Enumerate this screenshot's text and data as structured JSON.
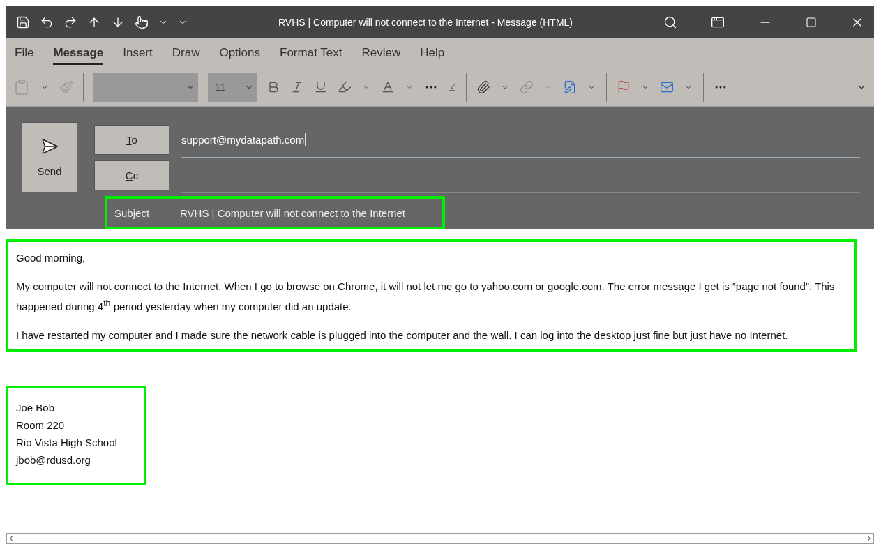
{
  "title_bar": {
    "title": "RVHS | Computer will not connect to the Internet  -  Message (HTML)"
  },
  "ribbon_tabs": [
    {
      "label": "File",
      "selected": false
    },
    {
      "label": "Message",
      "selected": true
    },
    {
      "label": "Insert",
      "selected": false
    },
    {
      "label": "Draw",
      "selected": false
    },
    {
      "label": "Options",
      "selected": false
    },
    {
      "label": "Format Text",
      "selected": false
    },
    {
      "label": "Review",
      "selected": false
    },
    {
      "label": "Help",
      "selected": false
    }
  ],
  "toolbar": {
    "font_name": {
      "disabled": true
    },
    "font_size": {
      "value": "11",
      "disabled": true
    }
  },
  "send_button": {
    "label": "Send"
  },
  "recipients": [
    {
      "label": "To",
      "value": "support@mydatapath.com",
      "focused": true
    },
    {
      "label": "Cc",
      "focused": false
    }
  ],
  "subject": {
    "label": "Subject",
    "value": "RVHS | Computer will not connect to the Internet",
    "highlighted": true
  },
  "body": {
    "highlighted": true,
    "paragraphs": [
      "Good morning,",
      "My computer will not connect to the Internet. When I go to browse on Chrome, it will not let me go to yahoo.com or google.com. The error message I get is “page not found”. This happened during 4$^{th}$ period yesterday when my computer did an update.",
      "I have restarted my computer and I made sure the network cable is plugged into the computer and the wall. I can log into the desktop just fine but just have no Internet."
    ]
  },
  "signature": {
    "highlighted": true,
    "lines": [
      "Joe Bob",
      "Room 220",
      "Rio Vista High School",
      "jbob@rdusd.org"
    ]
  }
}
